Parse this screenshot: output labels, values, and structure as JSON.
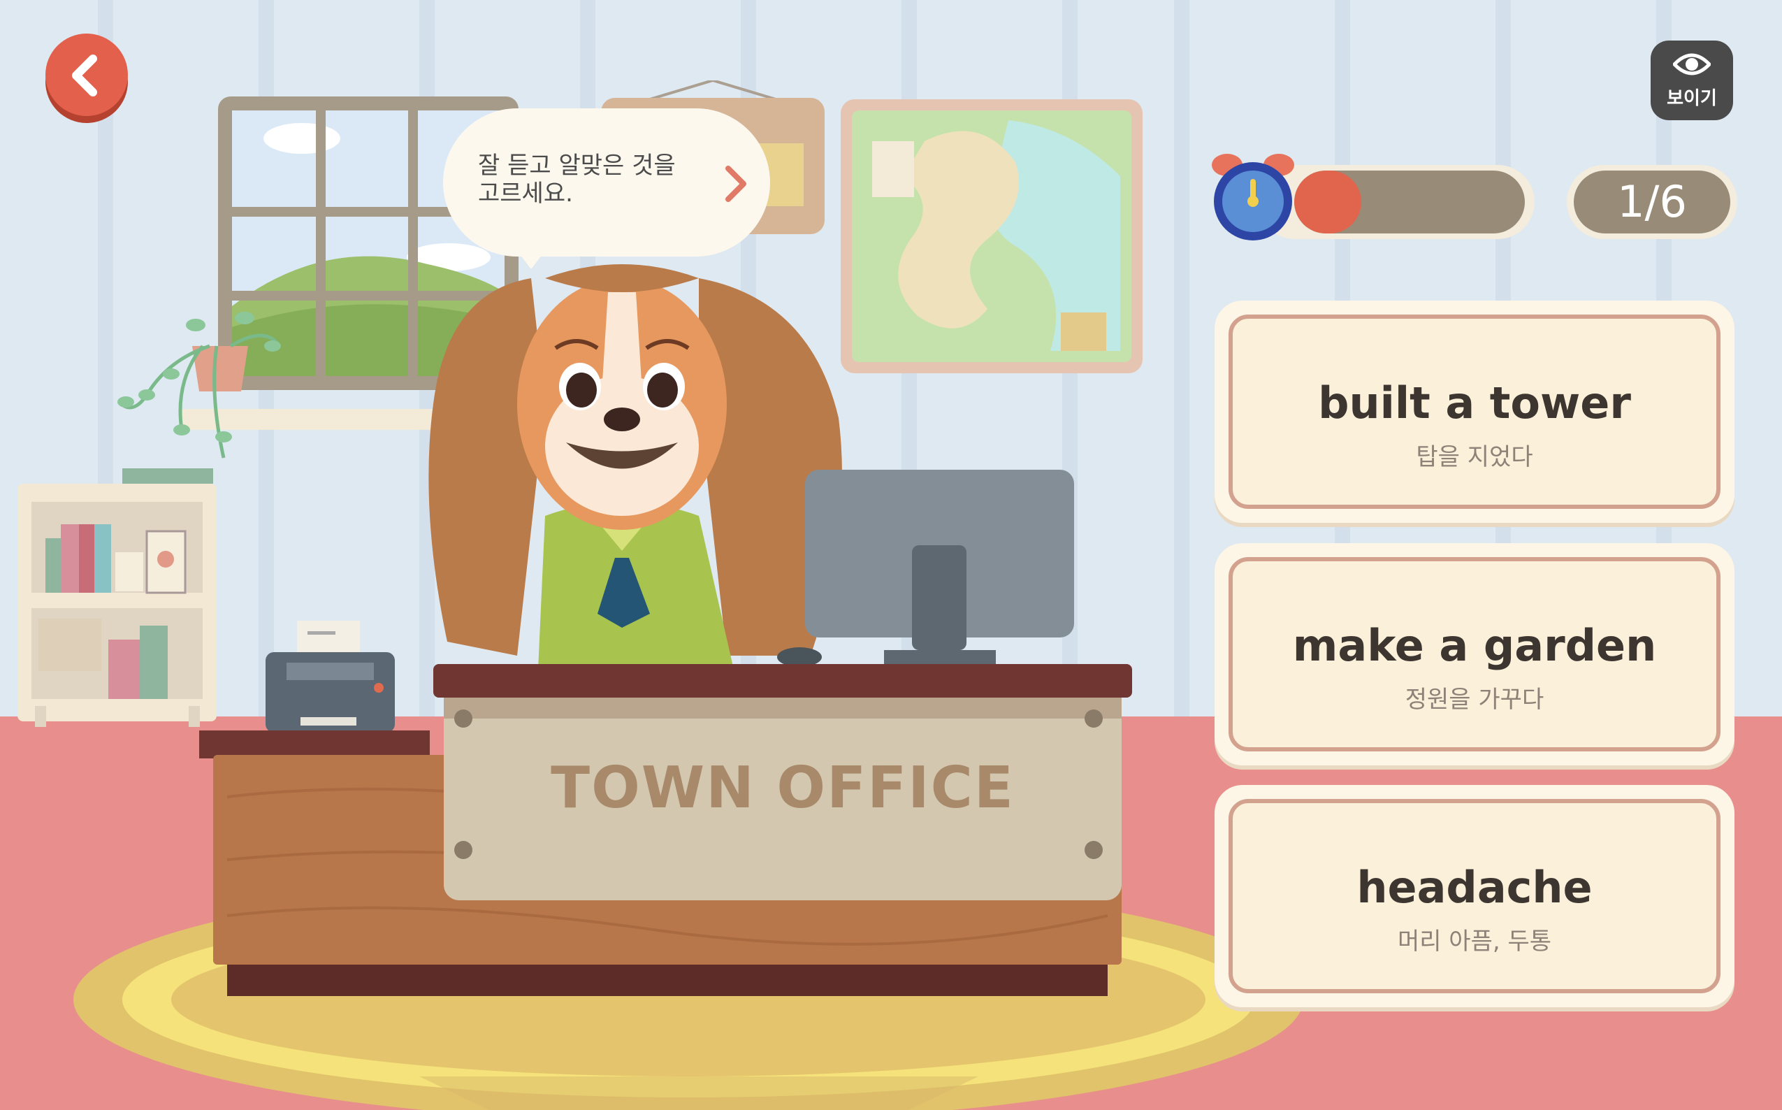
{
  "header": {
    "show_button_label": "보이기"
  },
  "bubble": {
    "instruction": "잘 듣고 알맞은 것을 고르세요."
  },
  "desk_sign": "TOWN OFFICE",
  "timer": {
    "remaining_fraction": 0.29
  },
  "progress": {
    "text": "1/6"
  },
  "answers": [
    {
      "english": "built a tower",
      "korean": "탑을 지었다"
    },
    {
      "english": "make a garden",
      "korean": "정원을 가꾸다"
    },
    {
      "english": "headache",
      "korean": "머리 아픔, 두통"
    }
  ],
  "colors": {
    "accent_red": "#e3604c",
    "floor": "#e88e8c",
    "wall": "#dfe9f2",
    "card_border": "#d3a28f",
    "pill": "#988b77"
  }
}
